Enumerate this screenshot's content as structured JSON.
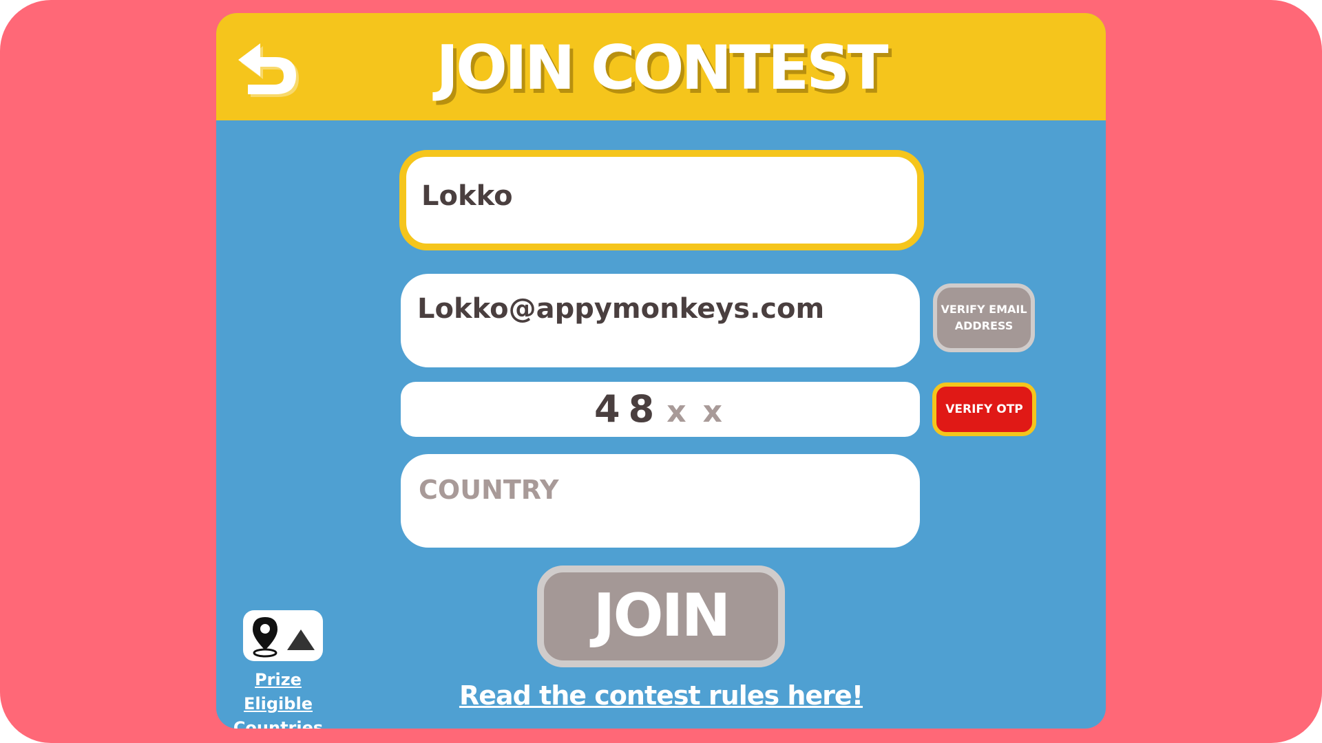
{
  "header": {
    "title": "JOIN CONTEST",
    "back_icon": "back-arrow-icon"
  },
  "form": {
    "name_value": "Lokko",
    "email_value": "Lokko@appymonkeys.com",
    "otp_digits": [
      "4",
      "8"
    ],
    "otp_placeholders": [
      "x",
      "x"
    ],
    "country_placeholder": "COUNTRY",
    "verify_email_label_line1": "VERIFY EMAIL",
    "verify_email_label_line2": "ADDRESS",
    "verify_otp_label": "VERIFY OTP",
    "join_label": "JOIN"
  },
  "footer": {
    "prize_line1": "Prize Eligible",
    "prize_line2": "Countries",
    "prize_icon": "map-pin-triangle-icon",
    "rules_link": "Read the contest rules here!"
  },
  "colors": {
    "background": "#FF6877",
    "panel": "#4FA0D2",
    "header": "#F5C51C",
    "disabled_button": "#A49896",
    "otp_button": "#E01916"
  }
}
